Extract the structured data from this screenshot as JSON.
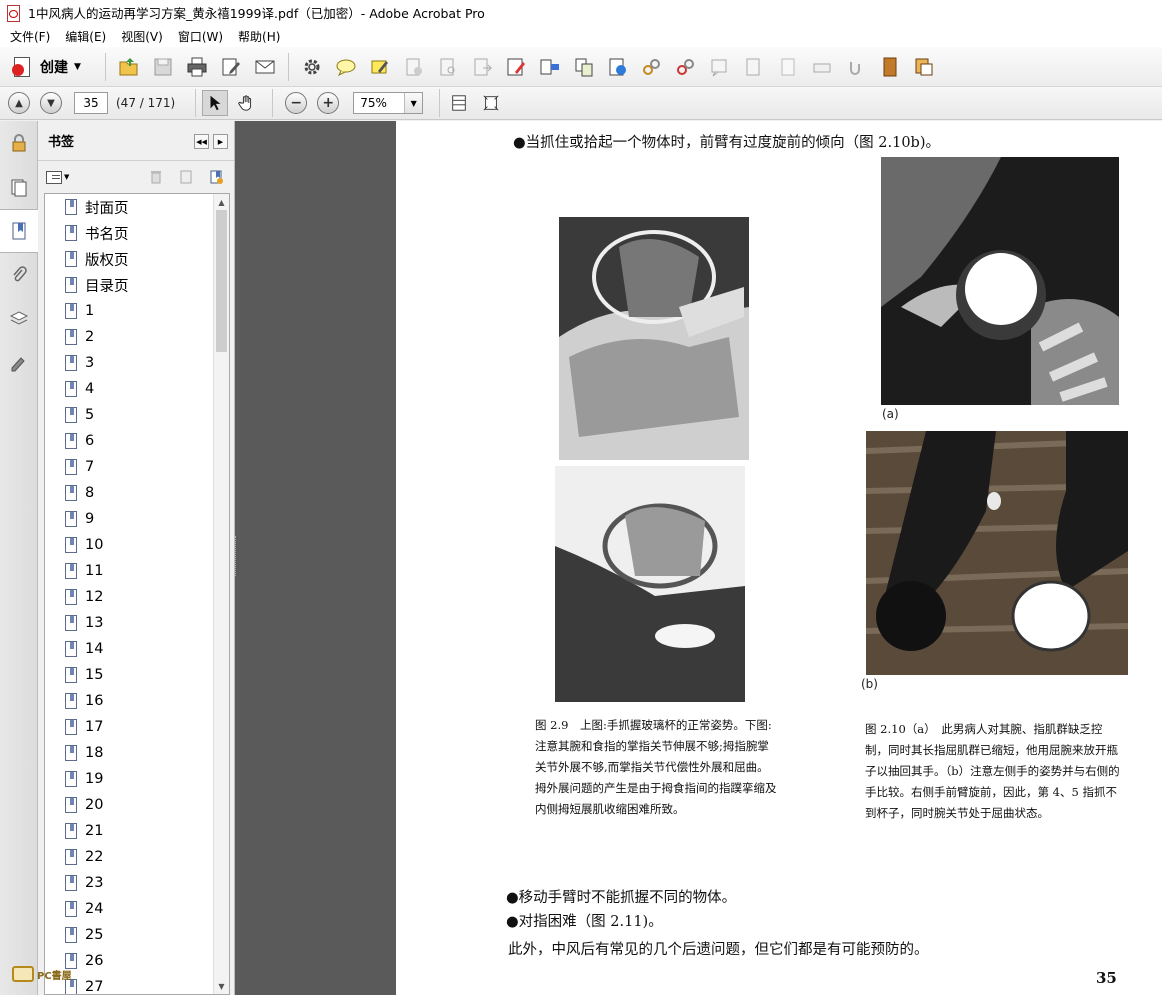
{
  "window": {
    "title": "1中风病人的运动再学习方案_黄永禧1999译.pdf（已加密）- Adobe Acrobat Pro"
  },
  "menu": {
    "items": [
      "文件(F)",
      "编辑(E)",
      "视图(V)",
      "窗口(W)",
      "帮助(H)"
    ]
  },
  "toolbar": {
    "create_label": "创建"
  },
  "navbar": {
    "page_number": "35",
    "page_count": "(47 / 171)",
    "zoom": "75%"
  },
  "bookmarks": {
    "title": "书签",
    "items": [
      "封面页",
      "书名页",
      "版权页",
      "目录页",
      "1",
      "2",
      "3",
      "4",
      "5",
      "6",
      "7",
      "8",
      "9",
      "10",
      "11",
      "12",
      "13",
      "14",
      "15",
      "16",
      "17",
      "18",
      "19",
      "20",
      "21",
      "22",
      "23",
      "24",
      "25",
      "26",
      "27"
    ]
  },
  "watermark": {
    "text": "PC書屋"
  },
  "document": {
    "line_top": "●当抓住或拾起一个物体时，前臂有过度旋前的倾向（图 2.10b)。",
    "fig_a_label": "(a)",
    "fig_b_label": "(b)",
    "caption_2_9": "图 2.9　上图:手抓握玻璃杯的正常姿势。下图:注意其腕和食指的掌指关节伸展不够;拇指腕掌关节外展不够,而掌指关节代偿性外展和屈曲。拇外展问题的产生是由于拇食指间的指蹼挛缩及内侧拇短展肌收缩困难所致。",
    "caption_2_10": "图 2.10（a）　此男病人对其腕、指肌群缺乏控制，同时其长指屈肌群已缩短，他用屈腕来放开瓶子以抽回其手。（b）注意左侧手的姿势并与右侧的手比较。右侧手前臂旋前，因此，第 4、5 指抓不到杯子，同时腕关节处于屈曲状态。",
    "line_1": "●移动手臂时不能抓握不同的物体。",
    "line_2": "●对指困难（图 2.11)。",
    "line_3": "此外，中风后有常见的几个后遗问题，但它们都是有可能预防的。",
    "page_number": "35"
  }
}
